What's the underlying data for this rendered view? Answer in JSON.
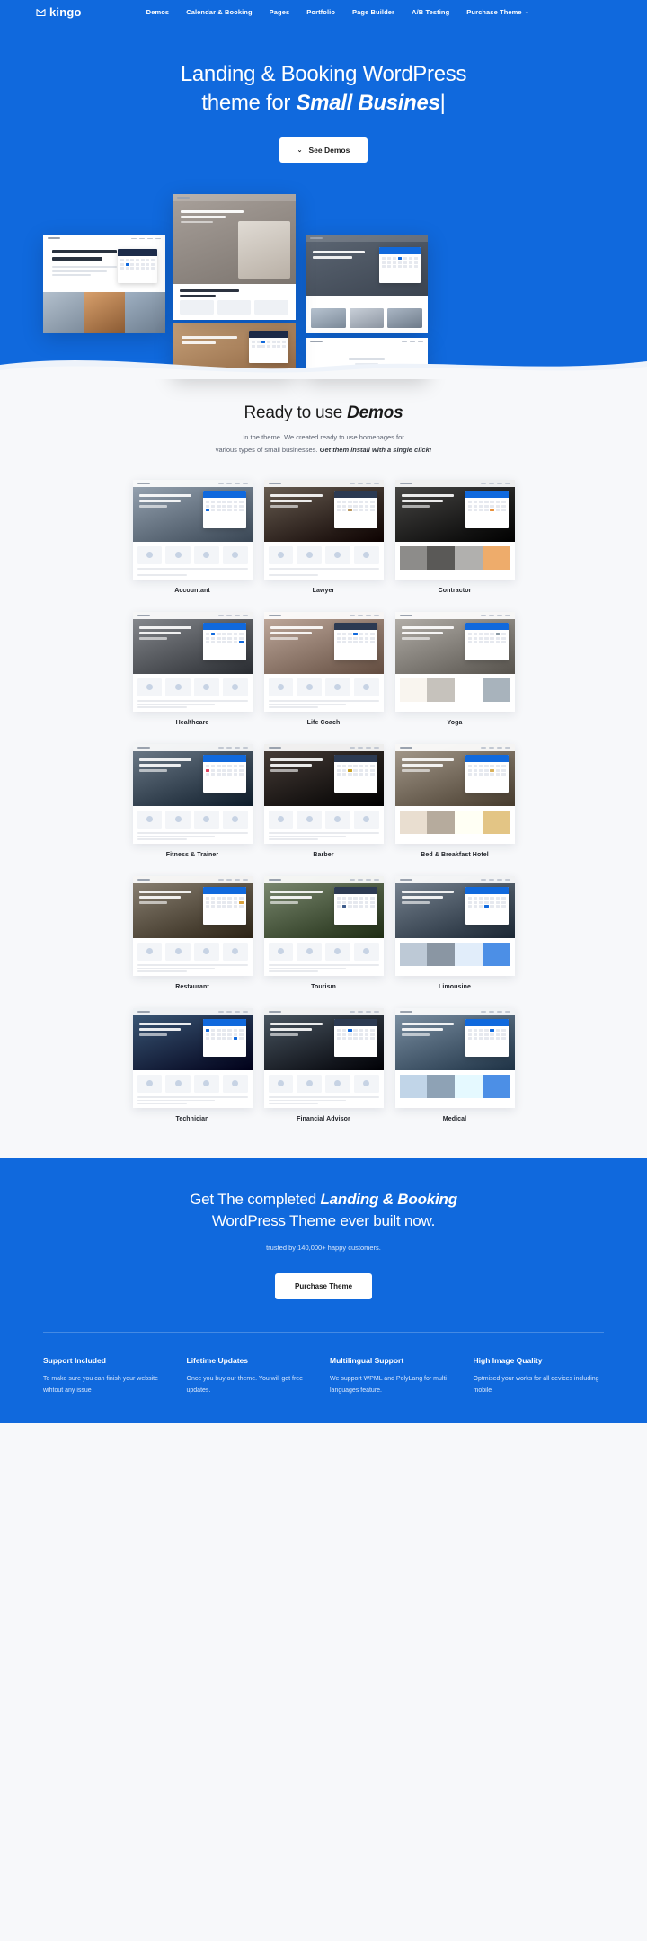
{
  "brand": {
    "name": "kingo",
    "accent": "#1069dd"
  },
  "nav": {
    "items": [
      {
        "label": "Demos",
        "caret": ""
      },
      {
        "label": "Calendar & Booking",
        "caret": ""
      },
      {
        "label": "Pages",
        "caret": ""
      },
      {
        "label": "Portfolio",
        "caret": ""
      },
      {
        "label": "Page Builder",
        "caret": ""
      },
      {
        "label": "A/B Testing",
        "caret": ""
      },
      {
        "label": "Purchase Theme",
        "caret": "⌄"
      }
    ]
  },
  "hero": {
    "title_line1": "Landing & Booking WordPress",
    "title_line2_prefix": "theme for ",
    "title_line2_em": "Small Busines",
    "caret": "|",
    "button_label": "See Demos",
    "button_icon": "chevron-down-icon"
  },
  "demos_section": {
    "title_prefix": "Ready to use ",
    "title_em": "Demos",
    "sub_line1": "In the theme. We created ready to use homepages for",
    "sub_line2_prefix": "various types of small businesses. ",
    "sub_line2_em": "Get them install with a single click!",
    "items": [
      {
        "label": "Accountant",
        "tint": "#9aa7b5",
        "accent": "#1069dd"
      },
      {
        "label": "Lawyer",
        "tint": "#6d6256",
        "accent": "#b8955f"
      },
      {
        "label": "Contractor",
        "tint": "#4b4a48",
        "accent": "#e8903a"
      },
      {
        "label": "Healthcare",
        "tint": "#8a8d92",
        "accent": "#1069dd"
      },
      {
        "label": "Life Coach",
        "tint": "#c3ada0",
        "accent": "#1069dd"
      },
      {
        "label": "Yoga",
        "tint": "#b7b3ad",
        "accent": "#8b9aa5"
      },
      {
        "label": "Fitness & Trainer",
        "tint": "#6f7d8b",
        "accent": "#e1435f"
      },
      {
        "label": "Barber",
        "tint": "#4a3f3a",
        "accent": "#c9a227"
      },
      {
        "label": "Bed & Breakfast Hotel",
        "tint": "#a79c8e",
        "accent": "#d9b25c"
      },
      {
        "label": "Restaurant",
        "tint": "#8d8476",
        "accent": "#d8a13c"
      },
      {
        "label": "Tourism",
        "tint": "#7f8d74",
        "accent": "#3f5d8c"
      },
      {
        "label": "Limousine",
        "tint": "#7b8794",
        "accent": "#1069dd"
      },
      {
        "label": "Technician",
        "tint": "#3d5b7a",
        "accent": "#1069dd"
      },
      {
        "label": "Financial Advisor",
        "tint": "#4d5a66",
        "accent": "#1069dd"
      },
      {
        "label": "Medical",
        "tint": "#7f93a6",
        "accent": "#1069dd"
      }
    ]
  },
  "cta": {
    "line1_prefix": "Get The completed ",
    "line1_em": "Landing & Booking",
    "line2": "WordPress Theme ever built now.",
    "sub": "trusted by 140,000+ happy customers.",
    "button_label": "Purchase Theme"
  },
  "footer": {
    "columns": [
      {
        "title": "Support Included",
        "text": "To make sure you can finish your website wihtout any issue"
      },
      {
        "title": "Lifetime Updates",
        "text": "Once you buy our theme. You will get free updates."
      },
      {
        "title": "Multilingual Support",
        "text": "We support WPML and PolyLang for multi languages feature."
      },
      {
        "title": "High Image Quality",
        "text": "Optmised your works for all devices including mobile"
      }
    ]
  }
}
